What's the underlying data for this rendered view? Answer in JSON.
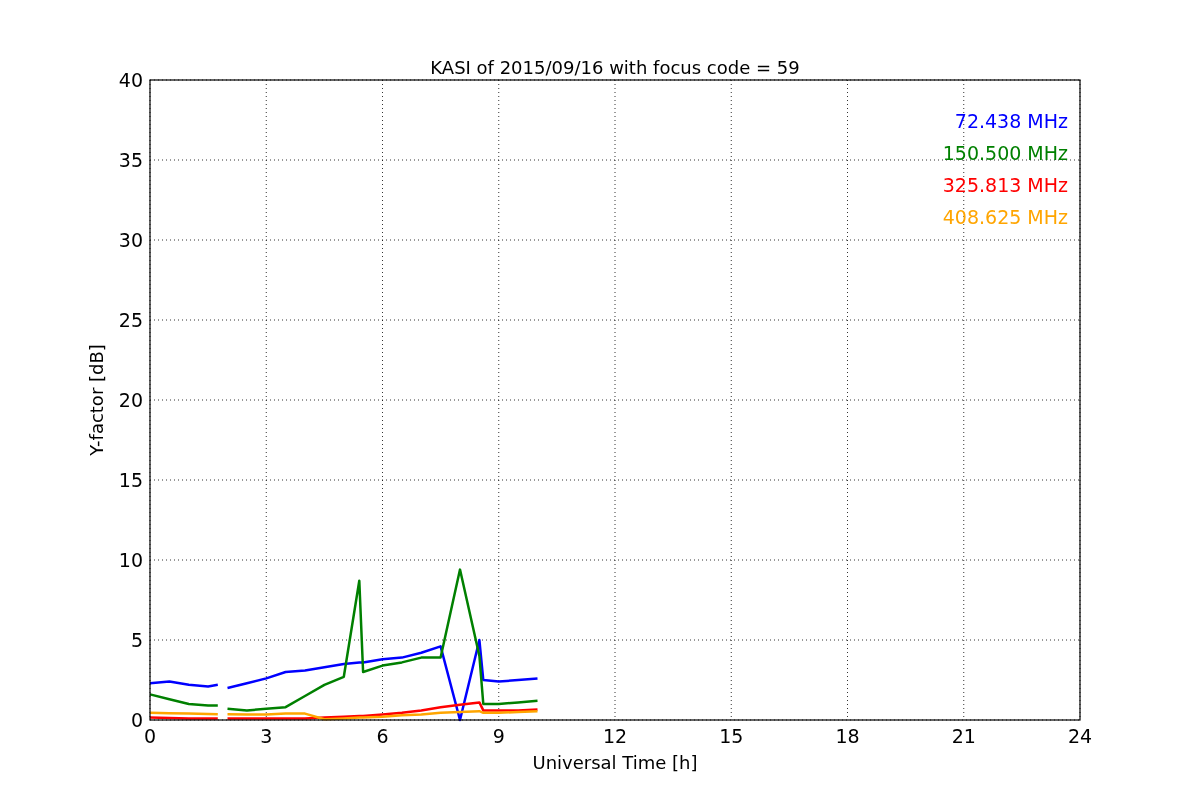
{
  "chart_data": {
    "type": "line",
    "title": "KASI of 2015/09/16 with focus code = 59",
    "xlabel": "Universal Time [h]",
    "ylabel": "Y-factor [dB]",
    "x": [
      0,
      0.5,
      1,
      1.5,
      1.75,
      1.9,
      2,
      2.5,
      3,
      3.5,
      4,
      4.5,
      5,
      5.4,
      5.5,
      6,
      6.5,
      7,
      7.5,
      8,
      8.5,
      8.6,
      9,
      9.5,
      10
    ],
    "series": [
      {
        "name": "72.438 MHz",
        "color": "#0000ff",
        "values": [
          2.3,
          2.4,
          2.2,
          2.1,
          2.2,
          null,
          2.0,
          2.3,
          2.6,
          3.0,
          3.1,
          3.3,
          3.5,
          3.6,
          3.6,
          3.8,
          3.9,
          4.2,
          4.6,
          0,
          5.0,
          2.5,
          2.4,
          2.5,
          2.6
        ]
      },
      {
        "name": "150.500 MHz",
        "color": "#008000",
        "values": [
          1.6,
          1.3,
          1.0,
          0.9,
          0.9,
          null,
          0.7,
          0.6,
          0.7,
          0.8,
          1.5,
          2.2,
          2.7,
          8.7,
          3.0,
          3.4,
          3.6,
          3.9,
          3.9,
          9.4,
          4.0,
          1.0,
          1.0,
          1.1,
          1.2
        ]
      },
      {
        "name": "325.813 MHz",
        "color": "#ff0000",
        "values": [
          0.15,
          0.12,
          0.1,
          0.1,
          0.1,
          null,
          0.1,
          0.1,
          0.1,
          0.1,
          0.1,
          0.15,
          0.2,
          0.25,
          0.25,
          0.35,
          0.45,
          0.6,
          0.8,
          0.95,
          1.1,
          0.6,
          0.6,
          0.6,
          0.65
        ]
      },
      {
        "name": "408.625 MHz",
        "color": "#ffa500",
        "values": [
          0.45,
          0.42,
          0.4,
          0.38,
          0.36,
          null,
          0.36,
          0.35,
          0.35,
          0.4,
          0.4,
          0.05,
          0.1,
          0.15,
          0.15,
          0.2,
          0.3,
          0.35,
          0.45,
          0.5,
          0.55,
          0.45,
          0.45,
          0.5,
          0.55
        ]
      }
    ],
    "grid": true,
    "xlim": [
      0,
      24
    ],
    "ylim": [
      0,
      40
    ],
    "xticks": [
      0,
      3,
      6,
      9,
      12,
      15,
      18,
      21,
      24
    ],
    "yticks": [
      0,
      5,
      10,
      15,
      20,
      25,
      30,
      35,
      40
    ]
  }
}
